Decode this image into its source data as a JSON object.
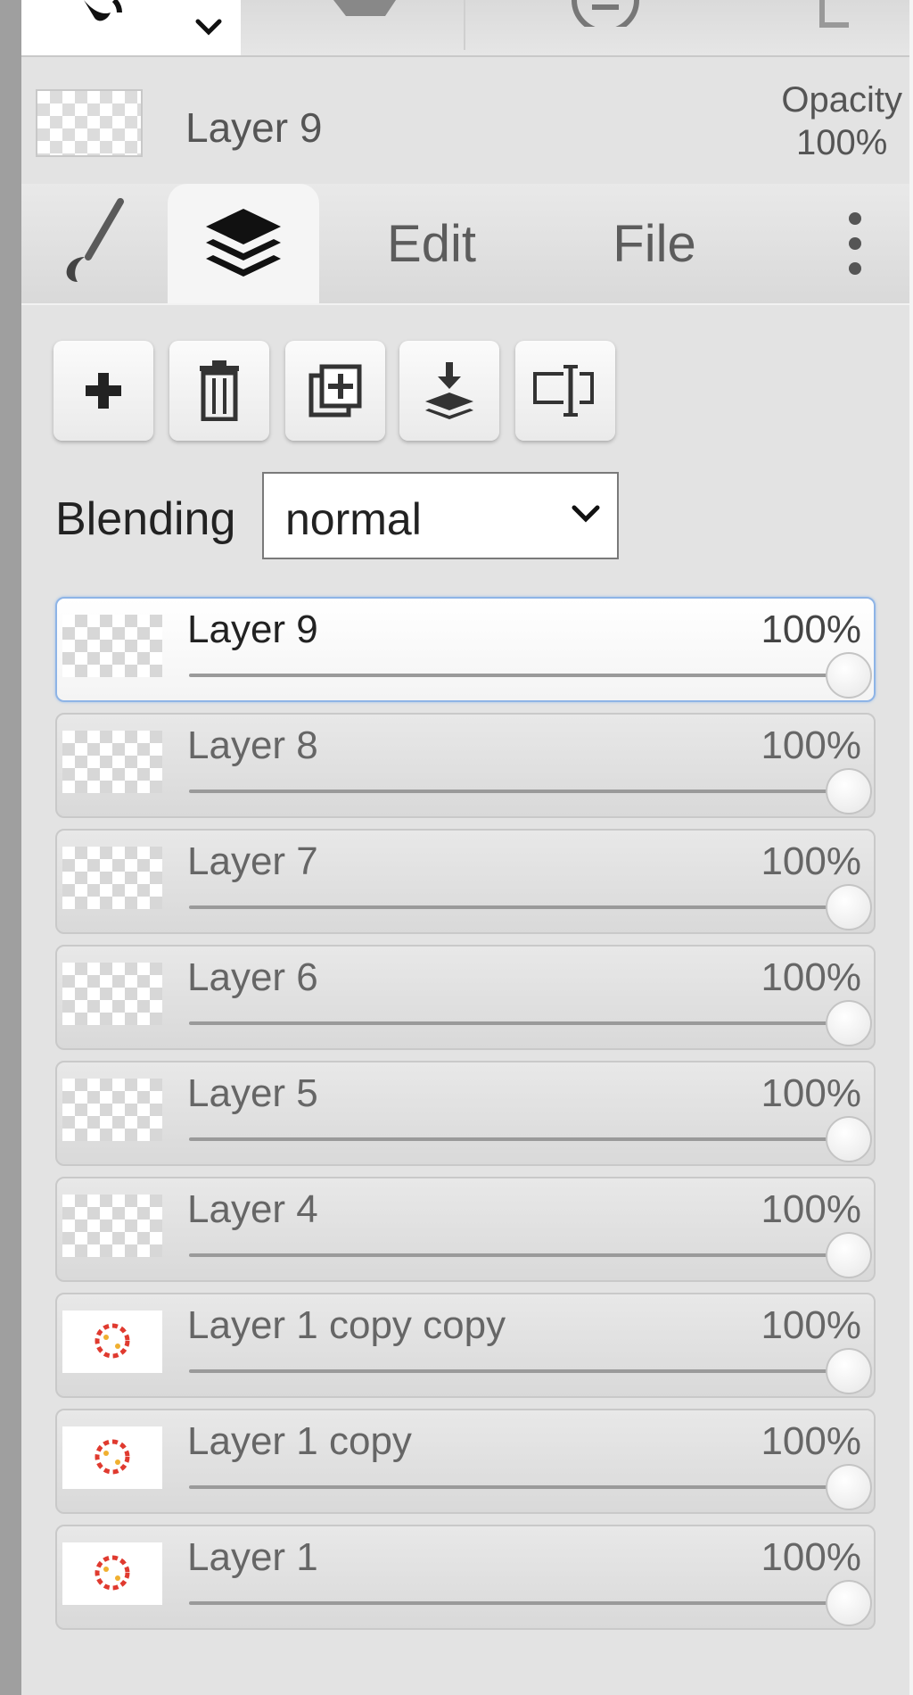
{
  "current_layer": {
    "name": "Layer 9",
    "opacity_label": "Opacity",
    "opacity_value": "100%"
  },
  "tabs": [
    {
      "label": "",
      "icon": "brush-icon"
    },
    {
      "label": "",
      "icon": "layers-icon"
    },
    {
      "label": "Edit"
    },
    {
      "label": "File"
    },
    {
      "label": "",
      "icon": "more-vertical-icon"
    }
  ],
  "layer_actions": [
    {
      "icon": "plus-icon"
    },
    {
      "icon": "trash-icon"
    },
    {
      "icon": "duplicate-icon"
    },
    {
      "icon": "merge-down-icon"
    },
    {
      "icon": "rename-icon"
    }
  ],
  "blending": {
    "label": "Blending",
    "value": "normal"
  },
  "layers": [
    {
      "name": "Layer 9",
      "opacity": 100,
      "opacity_text": "100%",
      "thumb": "checker",
      "selected": true
    },
    {
      "name": "Layer 8",
      "opacity": 100,
      "opacity_text": "100%",
      "thumb": "checker",
      "selected": false
    },
    {
      "name": "Layer 7",
      "opacity": 100,
      "opacity_text": "100%",
      "thumb": "checker",
      "selected": false
    },
    {
      "name": "Layer 6",
      "opacity": 100,
      "opacity_text": "100%",
      "thumb": "checker",
      "selected": false
    },
    {
      "name": "Layer 5",
      "opacity": 100,
      "opacity_text": "100%",
      "thumb": "checker",
      "selected": false
    },
    {
      "name": "Layer 4",
      "opacity": 100,
      "opacity_text": "100%",
      "thumb": "checker",
      "selected": false
    },
    {
      "name": "Layer 1 copy copy",
      "opacity": 100,
      "opacity_text": "100%",
      "thumb": "art",
      "selected": false
    },
    {
      "name": "Layer 1 copy",
      "opacity": 100,
      "opacity_text": "100%",
      "thumb": "art",
      "selected": false
    },
    {
      "name": "Layer 1",
      "opacity": 100,
      "opacity_text": "100%",
      "thumb": "art",
      "selected": false
    }
  ],
  "colors": {
    "selected_border": "#8eb4e6",
    "panel_bg": "#e3e3e3",
    "thumb_art": "#e03a2f"
  }
}
